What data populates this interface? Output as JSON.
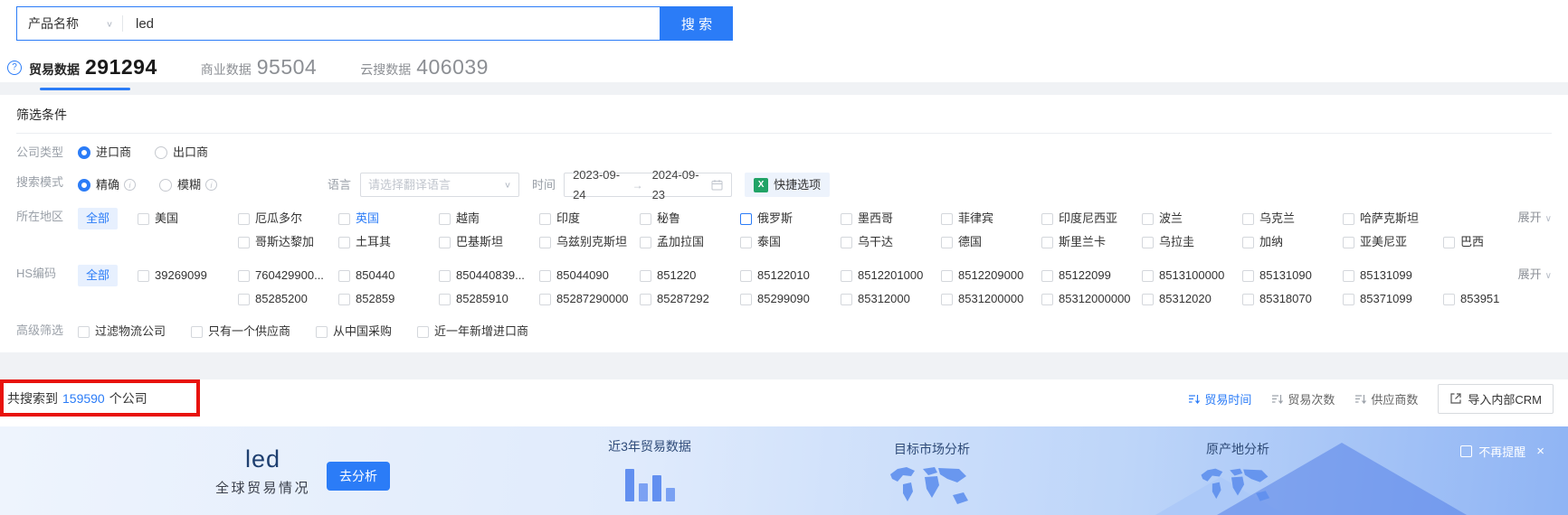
{
  "search": {
    "category_label": "产品名称",
    "query": "led",
    "button_label": "搜 索"
  },
  "tabs": [
    {
      "label": "贸易数据",
      "count": "291294",
      "active": true
    },
    {
      "label": "商业数据",
      "count": "95504",
      "active": false
    },
    {
      "label": "云搜数据",
      "count": "406039",
      "active": false
    }
  ],
  "filters": {
    "title": "筛选条件",
    "company_type": {
      "label": "公司类型",
      "options": [
        {
          "label": "进口商",
          "selected": true
        },
        {
          "label": "出口商",
          "selected": false
        }
      ]
    },
    "search_mode": {
      "label": "搜索模式",
      "options": [
        {
          "label": "精确",
          "selected": true
        },
        {
          "label": "模糊",
          "selected": false
        }
      ]
    },
    "language": {
      "label": "语言",
      "placeholder": "请选择翻译语言"
    },
    "time": {
      "label": "时间",
      "start": "2023-09-24",
      "end": "2024-09-23"
    },
    "quick_option_label": "快捷选项",
    "region": {
      "label": "所在地区",
      "all_label": "全部",
      "expand_label": "展开",
      "row1": [
        {
          "label": "美国"
        },
        {
          "label": "厄瓜多尔"
        },
        {
          "label": "英国",
          "highlight": true
        },
        {
          "label": "越南"
        },
        {
          "label": "印度"
        },
        {
          "label": "秘鲁"
        },
        {
          "label": "俄罗斯",
          "box": true
        },
        {
          "label": "墨西哥"
        },
        {
          "label": "菲律宾"
        },
        {
          "label": "印度尼西亚"
        },
        {
          "label": "波兰"
        },
        {
          "label": "乌克兰"
        },
        {
          "label": "哈萨克斯坦"
        }
      ],
      "row2": [
        {
          "label": "哥斯达黎加"
        },
        {
          "label": "土耳其"
        },
        {
          "label": "巴基斯坦"
        },
        {
          "label": "乌兹别克斯坦"
        },
        {
          "label": "孟加拉国"
        },
        {
          "label": "泰国"
        },
        {
          "label": "乌干达"
        },
        {
          "label": "德国"
        },
        {
          "label": "斯里兰卡"
        },
        {
          "label": "乌拉圭"
        },
        {
          "label": "加纳"
        },
        {
          "label": "亚美尼亚"
        },
        {
          "label": "巴西"
        }
      ]
    },
    "hs_code": {
      "label": "HS编码",
      "all_label": "全部",
      "expand_label": "展开",
      "row1": [
        {
          "label": "39269099"
        },
        {
          "label": "760429900..."
        },
        {
          "label": "850440"
        },
        {
          "label": "850440839..."
        },
        {
          "label": "85044090"
        },
        {
          "label": "851220"
        },
        {
          "label": "85122010"
        },
        {
          "label": "8512201000"
        },
        {
          "label": "8512209000"
        },
        {
          "label": "85122099"
        },
        {
          "label": "8513100000"
        },
        {
          "label": "85131090"
        },
        {
          "label": "85131099"
        }
      ],
      "row2": [
        {
          "label": "85285200"
        },
        {
          "label": "852859"
        },
        {
          "label": "85285910"
        },
        {
          "label": "85287290000"
        },
        {
          "label": "85287292"
        },
        {
          "label": "85299090"
        },
        {
          "label": "85312000"
        },
        {
          "label": "8531200000"
        },
        {
          "label": "85312000000"
        },
        {
          "label": "85312020"
        },
        {
          "label": "85318070"
        },
        {
          "label": "85371099"
        },
        {
          "label": "853951"
        }
      ]
    },
    "advanced": {
      "label": "高级筛选",
      "options": [
        {
          "label": "过滤物流公司"
        },
        {
          "label": "只有一个供应商"
        },
        {
          "label": "从中国采购"
        },
        {
          "label": "近一年新增进口商"
        }
      ]
    }
  },
  "results": {
    "prefix": "共搜索到",
    "count": "159590",
    "suffix": "个公司",
    "sorts": [
      {
        "label": "贸易时间",
        "active": true
      },
      {
        "label": "贸易次数",
        "active": false
      },
      {
        "label": "供应商数",
        "active": false
      }
    ],
    "crm_button_label": "导入内部CRM"
  },
  "banner": {
    "keyword": "led",
    "subtitle": "全球贸易情况",
    "analyze_button_label": "去分析",
    "features": [
      "近3年贸易数据",
      "目标市场分析",
      "原产地分析"
    ],
    "dismiss_label": "不再提醒"
  },
  "colors": {
    "primary": "#2b7cf7",
    "annotation_red": "#e8120c",
    "banner_blue": "#8fb4f4"
  }
}
